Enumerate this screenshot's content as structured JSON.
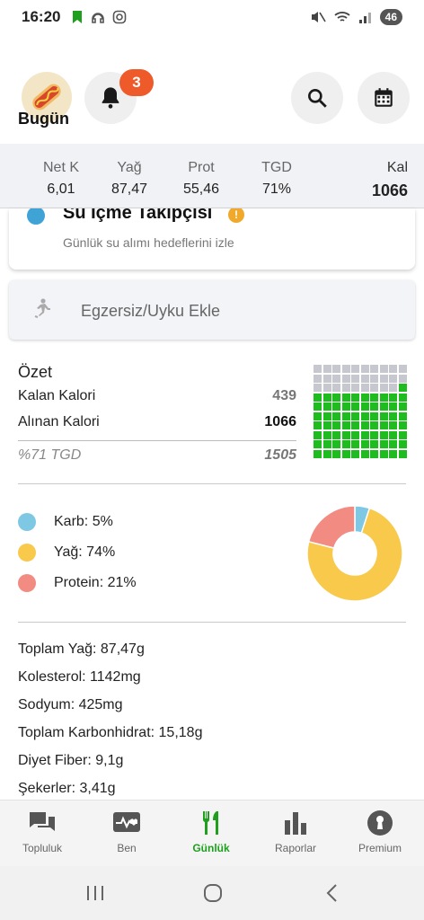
{
  "status_bar": {
    "time": "16:20",
    "battery": "46"
  },
  "header": {
    "notification_count": "3",
    "page_title": "Bugün"
  },
  "macro_strip": [
    {
      "label": "Net K",
      "value": "6,01"
    },
    {
      "label": "Yağ",
      "value": "87,47"
    },
    {
      "label": "Prot",
      "value": "55,46"
    },
    {
      "label": "TGD",
      "value": "71%"
    },
    {
      "label": "Kal",
      "value": "1066"
    }
  ],
  "water_card": {
    "title": "Su İçme Takipçisi",
    "subtitle": "Günlük su alımı hedeflerini izle"
  },
  "exercise": {
    "label": "Egzersiz/Uyku Ekle"
  },
  "summary": {
    "title": "Özet",
    "remaining_label": "Kalan Kalori",
    "remaining_value": "439",
    "consumed_label": "Alınan Kalori",
    "consumed_value": "1066",
    "tgd_label": "%71 TGD",
    "tgd_value": "1505",
    "progress_fraction": 0.71
  },
  "macros": {
    "carb_label": "Karb: 5%",
    "fat_label": "Yağ: 74%",
    "protein_label": "Protein: 21%",
    "carb_pct": 5,
    "fat_pct": 74,
    "protein_pct": 21,
    "colors": {
      "carb": "#7ec8e3",
      "fat": "#f9c94c",
      "protein": "#f28b82"
    }
  },
  "nutrients": [
    "Toplam Yağ: 87,47g",
    "Kolesterol: 1142mg",
    "Sodyum: 425mg",
    "Toplam Karbonhidrat: 15,18g",
    "Diyet Fiber: 9,1g",
    "Şekerler: 3,41g"
  ],
  "bottom_nav": [
    {
      "label": "Topluluk",
      "icon": "chat-icon"
    },
    {
      "label": "Ben",
      "icon": "heart-pulse-icon"
    },
    {
      "label": "Günlük",
      "icon": "fork-knife-icon",
      "active": true
    },
    {
      "label": "Raporlar",
      "icon": "bar-chart-icon"
    },
    {
      "label": "Premium",
      "icon": "keyhole-icon"
    }
  ],
  "accent_color": "#1ea01e"
}
